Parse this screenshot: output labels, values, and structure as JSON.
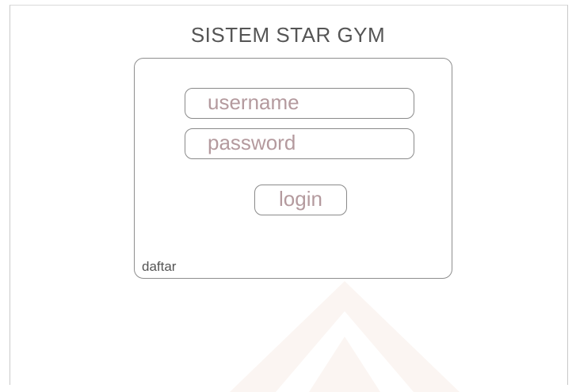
{
  "header": {
    "title": "SISTEM STAR GYM"
  },
  "login_form": {
    "username": {
      "placeholder": "username",
      "value": ""
    },
    "password": {
      "placeholder": "password",
      "value": ""
    },
    "login_label": "login",
    "register_link_label": "daftar"
  },
  "colors": {
    "placeholder_text": "#b49a9e",
    "border": "#8a8a8a",
    "text": "#555555",
    "background": "#ffffff"
  }
}
